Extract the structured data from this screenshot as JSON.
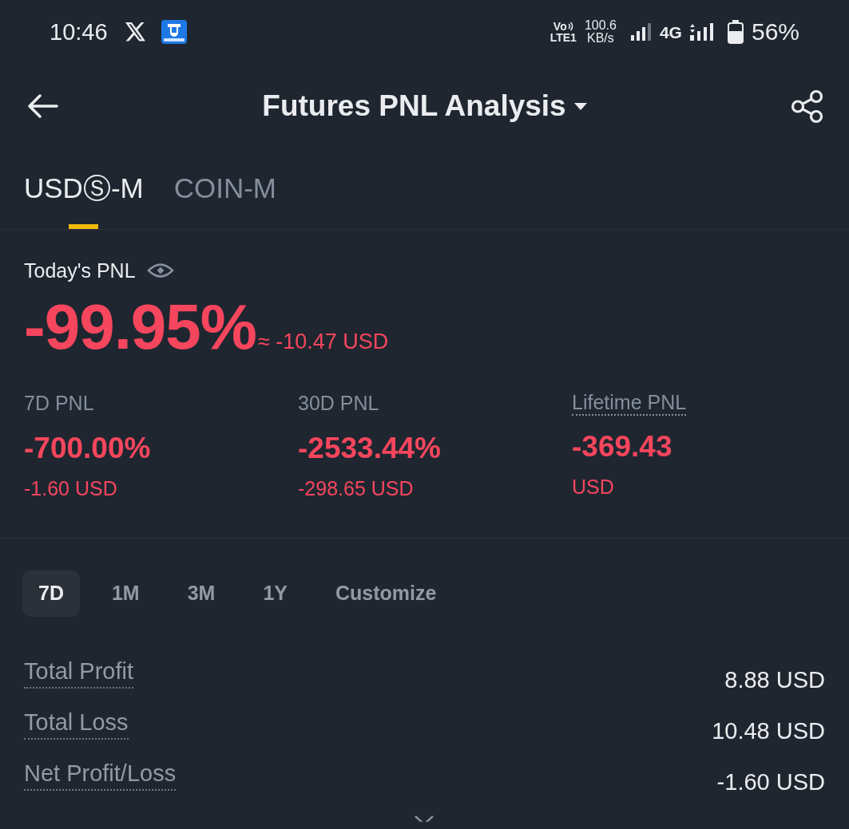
{
  "status_bar": {
    "time": "10:46",
    "volte_top": "Vo",
    "volte_bottom": "LTE1",
    "speed": "100.6",
    "speed_unit": "KB/s",
    "network": "4G",
    "battery": "56%"
  },
  "header": {
    "title": "Futures PNL Analysis"
  },
  "tabs": [
    {
      "label": "USDⓈ-M",
      "selected": true
    },
    {
      "label": "COIN-M",
      "selected": false
    }
  ],
  "today": {
    "label": "Today's PNL",
    "percent": "-99.95%",
    "amount": "≈ -10.47 USD"
  },
  "stats": [
    {
      "label": "7D PNL",
      "tooltip": false,
      "value": "-700.00%",
      "sub": "-1.60 USD"
    },
    {
      "label": "30D PNL",
      "tooltip": false,
      "value": "-2533.44%",
      "sub": "-298.65 USD"
    },
    {
      "label": "Lifetime PNL",
      "tooltip": true,
      "value": "-369.43",
      "sub": "USD"
    }
  ],
  "periods": [
    {
      "label": "7D",
      "selected": true
    },
    {
      "label": "1M",
      "selected": false
    },
    {
      "label": "3M",
      "selected": false
    },
    {
      "label": "1Y",
      "selected": false
    },
    {
      "label": "Customize",
      "selected": false
    }
  ],
  "summary": [
    {
      "label": "Total Profit",
      "value": "8.88 USD"
    },
    {
      "label": "Total Loss",
      "value": "10.48 USD"
    },
    {
      "label": "Net Profit/Loss",
      "value": "-1.60 USD"
    }
  ]
}
